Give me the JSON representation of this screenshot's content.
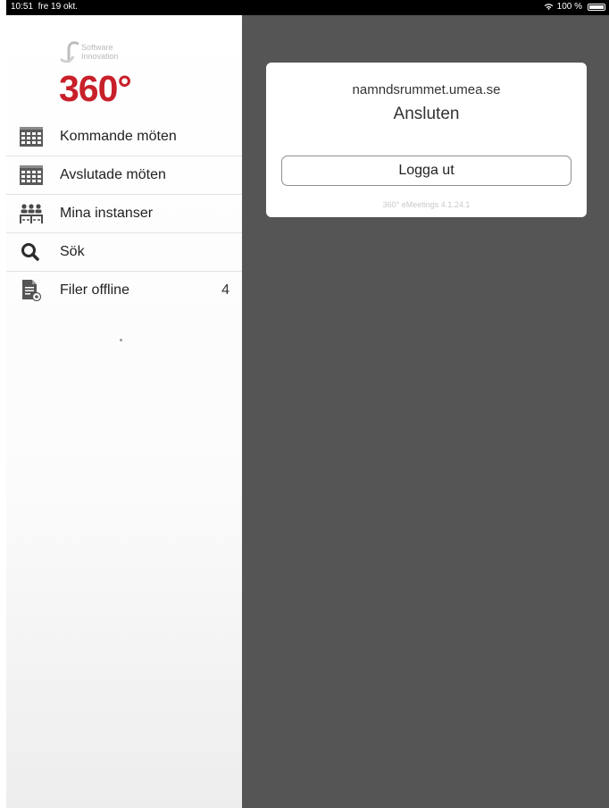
{
  "status_bar": {
    "time": "10:51",
    "date": "fre 19 okt.",
    "wifi_icon": "wifi-icon",
    "battery": "100 %",
    "battery_icon": "battery-icon"
  },
  "sidebar": {
    "logo": {
      "line1": "Software",
      "line2": "Innovation",
      "number": "360°",
      "brand_color": "#c8202a"
    },
    "items": [
      {
        "label": "Kommande möten",
        "icon": "calendar-icon",
        "count": ""
      },
      {
        "label": "Avslutade möten",
        "icon": "calendar-icon",
        "count": ""
      },
      {
        "label": "Mina instanser",
        "icon": "people-group-icon",
        "count": ""
      },
      {
        "label": "Sök",
        "icon": "search-icon",
        "count": ""
      },
      {
        "label": "Filer offline",
        "icon": "offline-file-icon",
        "count": "4"
      }
    ]
  },
  "card": {
    "host": "namndsrummet.umea.se",
    "status": "Ansluten",
    "logout_label": "Logga ut",
    "version": "360° eMeetings 4.1.24.1"
  },
  "colors": {
    "content_background": "#555555",
    "status_bar": "#000000",
    "accent_red": "#c8202a"
  }
}
